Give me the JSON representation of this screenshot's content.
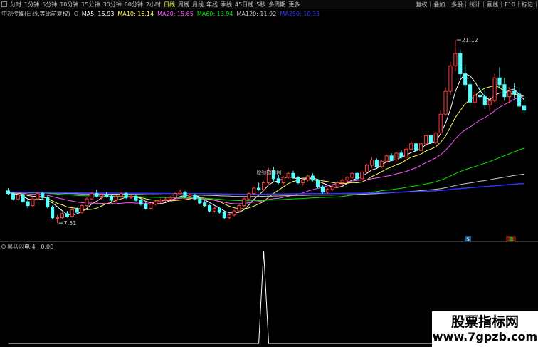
{
  "toolbar": {
    "periods": [
      "分时",
      "1分钟",
      "5分钟",
      "10分钟",
      "15分钟",
      "30分钟",
      "60分钟",
      "2小时",
      "日线",
      "周线",
      "月线",
      "年线",
      "季线",
      "45日线",
      "5秒",
      "多周期",
      "更多"
    ],
    "active_period": "日线",
    "tools": [
      "复权",
      "叠加",
      "多股",
      "统计",
      "画线",
      "F10",
      "标记"
    ]
  },
  "legend": {
    "title": "中视传媒(日线,等比前复权)",
    "ma5": "MA5: 15.93",
    "ma10": "MA10: 16.14",
    "ma20": "MA20: 15.65",
    "ma60": "MA60: 13.94",
    "ma120": "MA120: 11.92",
    "ma250": "MA250: 10.33"
  },
  "colors": {
    "up": "#ff3c3c",
    "down": "#54ffff",
    "ma5": "#ffffff",
    "ma10": "#ffff54",
    "ma20": "#ff54ff",
    "ma60": "#00e600",
    "ma120": "#c8c8c8",
    "ma250": "#3333ff",
    "active_period": "#ffff54"
  },
  "chart_data": {
    "type": "candlestick",
    "high_label": "21.12",
    "low_label": "7.51",
    "center_label": "股标指标网",
    "markers": [
      "S",
      "满"
    ],
    "ylim": [
      6.5,
      22.5
    ],
    "ohlc": [
      [
        9.9,
        10.1,
        9.6,
        9.7
      ],
      [
        9.7,
        9.8,
        9.2,
        9.3
      ],
      [
        9.3,
        9.7,
        9.2,
        9.6
      ],
      [
        9.6,
        9.7,
        9.0,
        9.1
      ],
      [
        9.1,
        9.3,
        8.6,
        8.8
      ],
      [
        8.8,
        9.4,
        8.7,
        9.3
      ],
      [
        9.3,
        9.8,
        9.2,
        9.7
      ],
      [
        9.7,
        9.8,
        9.3,
        9.4
      ],
      [
        9.4,
        9.5,
        8.6,
        8.7
      ],
      [
        8.7,
        8.8,
        7.8,
        7.9
      ],
      [
        7.9,
        8.1,
        7.5,
        7.9
      ],
      [
        7.9,
        8.3,
        7.8,
        8.2
      ],
      [
        8.2,
        8.4,
        7.9,
        8.0
      ],
      [
        8.0,
        8.6,
        7.9,
        8.5
      ],
      [
        8.5,
        8.7,
        8.2,
        8.3
      ],
      [
        8.3,
        8.9,
        8.2,
        8.8
      ],
      [
        8.8,
        9.4,
        8.7,
        9.3
      ],
      [
        9.3,
        9.8,
        9.2,
        9.7
      ],
      [
        9.7,
        10.0,
        9.4,
        9.5
      ],
      [
        9.5,
        9.7,
        9.2,
        9.6
      ],
      [
        9.6,
        9.8,
        9.4,
        9.5
      ],
      [
        9.5,
        9.6,
        9.1,
        9.2
      ],
      [
        9.2,
        9.6,
        9.1,
        9.5
      ],
      [
        9.5,
        9.8,
        9.4,
        9.7
      ],
      [
        9.7,
        9.8,
        9.3,
        9.4
      ],
      [
        9.4,
        9.6,
        9.3,
        9.5
      ],
      [
        9.5,
        9.6,
        9.1,
        9.2
      ],
      [
        9.2,
        9.3,
        8.8,
        8.9
      ],
      [
        8.9,
        9.1,
        8.5,
        8.6
      ],
      [
        8.6,
        9.0,
        8.5,
        8.9
      ],
      [
        8.9,
        9.2,
        8.8,
        9.1
      ],
      [
        9.1,
        9.3,
        9.0,
        9.2
      ],
      [
        9.2,
        9.4,
        9.1,
        9.3
      ],
      [
        9.3,
        9.5,
        9.2,
        9.4
      ],
      [
        9.4,
        9.8,
        9.3,
        9.7
      ],
      [
        9.7,
        10.0,
        9.6,
        9.8
      ],
      [
        9.8,
        9.9,
        9.4,
        9.5
      ],
      [
        9.5,
        9.7,
        9.4,
        9.6
      ],
      [
        9.6,
        9.7,
        9.2,
        9.3
      ],
      [
        9.3,
        9.4,
        8.9,
        9.0
      ],
      [
        9.0,
        9.2,
        8.7,
        8.8
      ],
      [
        8.8,
        8.9,
        8.3,
        8.4
      ],
      [
        8.4,
        8.7,
        8.3,
        8.6
      ],
      [
        8.6,
        8.7,
        8.2,
        8.3
      ],
      [
        8.3,
        8.4,
        7.8,
        7.9
      ],
      [
        7.9,
        8.2,
        7.8,
        8.1
      ],
      [
        8.1,
        8.5,
        8.0,
        8.4
      ],
      [
        8.4,
        8.9,
        8.3,
        8.8
      ],
      [
        8.8,
        9.4,
        8.7,
        9.3
      ],
      [
        9.3,
        9.8,
        9.2,
        9.7
      ],
      [
        9.7,
        10.2,
        9.6,
        10.1
      ],
      [
        10.1,
        10.5,
        9.9,
        10.0
      ],
      [
        10.0,
        10.6,
        9.9,
        10.5
      ],
      [
        10.5,
        11.6,
        10.4,
        11.4
      ],
      [
        11.4,
        11.7,
        10.6,
        10.8
      ],
      [
        10.8,
        11.1,
        10.4,
        10.5
      ],
      [
        10.5,
        11.0,
        10.4,
        10.9
      ],
      [
        10.9,
        11.3,
        10.8,
        11.2
      ],
      [
        11.2,
        11.4,
        10.8,
        10.9
      ],
      [
        10.9,
        11.0,
        10.4,
        10.5
      ],
      [
        10.5,
        10.8,
        10.3,
        10.7
      ],
      [
        10.7,
        11.1,
        10.6,
        11.0
      ],
      [
        11.0,
        11.2,
        10.6,
        10.7
      ],
      [
        10.7,
        10.8,
        10.1,
        10.2
      ],
      [
        10.2,
        10.3,
        9.7,
        9.8
      ],
      [
        9.8,
        10.1,
        9.7,
        10.0
      ],
      [
        10.0,
        10.3,
        9.9,
        10.2
      ],
      [
        10.2,
        10.6,
        10.1,
        10.5
      ],
      [
        10.5,
        10.8,
        10.4,
        10.7
      ],
      [
        10.7,
        11.0,
        10.5,
        10.9
      ],
      [
        10.9,
        11.3,
        10.8,
        11.2
      ],
      [
        11.2,
        11.3,
        10.7,
        10.8
      ],
      [
        10.8,
        11.4,
        10.7,
        11.3
      ],
      [
        11.3,
        11.9,
        11.2,
        11.8
      ],
      [
        11.8,
        12.4,
        11.6,
        12.2
      ],
      [
        12.2,
        12.3,
        11.6,
        11.7
      ],
      [
        11.7,
        12.2,
        11.6,
        12.1
      ],
      [
        12.1,
        12.6,
        12.0,
        12.5
      ],
      [
        12.5,
        12.7,
        12.1,
        12.2
      ],
      [
        12.2,
        12.8,
        12.1,
        12.7
      ],
      [
        12.7,
        12.9,
        12.3,
        12.4
      ],
      [
        12.4,
        13.1,
        12.3,
        13.0
      ],
      [
        13.0,
        13.6,
        12.9,
        13.4
      ],
      [
        13.4,
        13.5,
        12.8,
        12.9
      ],
      [
        12.9,
        13.5,
        12.8,
        13.4
      ],
      [
        13.4,
        14.2,
        13.3,
        14.0
      ],
      [
        14.0,
        14.1,
        13.4,
        13.5
      ],
      [
        13.5,
        14.3,
        13.4,
        14.2
      ],
      [
        14.2,
        15.9,
        14.1,
        15.6
      ],
      [
        15.6,
        17.6,
        15.5,
        17.3
      ],
      [
        17.3,
        19.5,
        17.0,
        19.2
      ],
      [
        19.2,
        21.12,
        18.8,
        20.1
      ],
      [
        20.1,
        20.4,
        18.2,
        18.6
      ],
      [
        18.6,
        19.3,
        17.4,
        17.8
      ],
      [
        17.8,
        18.1,
        16.2,
        16.5
      ],
      [
        16.5,
        17.3,
        16.1,
        17.0
      ],
      [
        17.0,
        17.8,
        16.6,
        16.9
      ],
      [
        16.9,
        17.4,
        16.0,
        16.3
      ],
      [
        16.3,
        16.9,
        15.8,
        16.6
      ],
      [
        16.6,
        18.6,
        16.4,
        18.3
      ],
      [
        18.3,
        19.1,
        17.5,
        17.8
      ],
      [
        17.8,
        18.3,
        16.6,
        16.9
      ],
      [
        16.9,
        17.6,
        16.4,
        17.3
      ],
      [
        17.3,
        17.9,
        16.8,
        17.1
      ],
      [
        17.1,
        17.6,
        16.1,
        16.2
      ],
      [
        16.2,
        16.8,
        15.6,
        15.9
      ]
    ],
    "sub_indicator": {
      "name": "黑马闪电.4",
      "value": "0.00",
      "signal_index": 52,
      "signal_value": 1
    }
  }
}
